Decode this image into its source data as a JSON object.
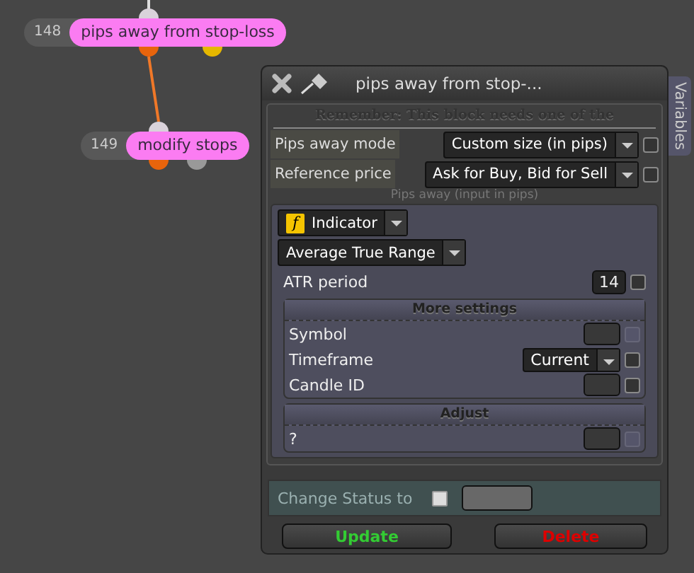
{
  "nodes": [
    {
      "id_label": "148",
      "title": "pips away from stop-loss"
    },
    {
      "id_label": "149",
      "title": "modify stops"
    }
  ],
  "dialog": {
    "title": "pips away from stop-...",
    "side_tab": "Variables",
    "notice": "Remember: This block needs one of the",
    "top_rows": [
      {
        "label": "Pips away mode",
        "value": "Custom size (in pips)",
        "checked": false
      },
      {
        "label": "Reference price",
        "value": "Ask for Buy, Bid for Sell",
        "checked": false
      }
    ],
    "section_caption": "Pips away (input in pips)",
    "source": {
      "type": "Indicator",
      "icon": "f",
      "indicator": "Average True Range"
    },
    "period": {
      "label": "ATR period",
      "value": "14",
      "checked": false
    },
    "groups": [
      {
        "title": "More settings",
        "rows": [
          {
            "label": "Symbol",
            "kind": "field",
            "value": "",
            "disabled": true
          },
          {
            "label": "Timeframe",
            "kind": "select",
            "value": "Current",
            "disabled": false
          },
          {
            "label": "Candle ID",
            "kind": "field",
            "value": "",
            "disabled": false
          }
        ]
      },
      {
        "title": "Adjust",
        "rows": [
          {
            "label": "?",
            "kind": "field",
            "value": "",
            "disabled": true
          }
        ]
      }
    ],
    "status": {
      "label": "Change Status to",
      "checked": false
    },
    "buttons": [
      {
        "label": "Update",
        "kind": "update"
      },
      {
        "label": "Delete",
        "kind": "delete"
      }
    ]
  }
}
